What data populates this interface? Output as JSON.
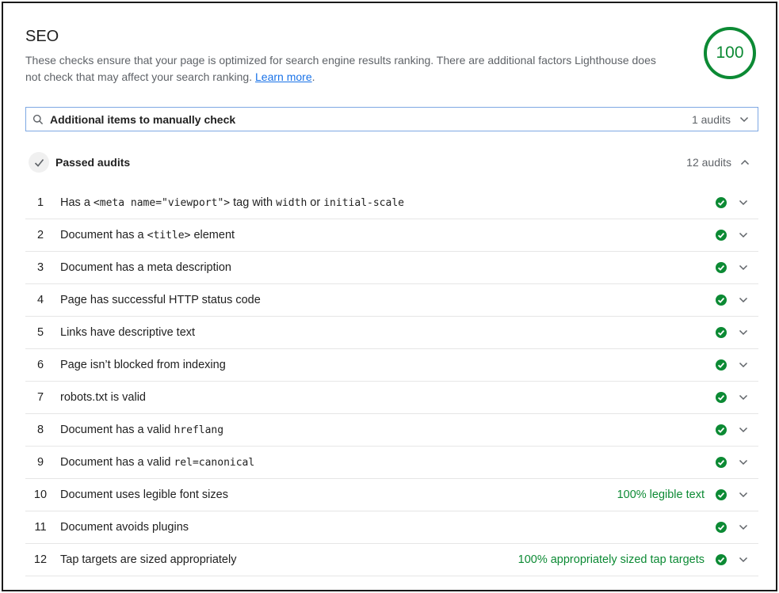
{
  "section": {
    "title": "SEO",
    "description": "These checks ensure that your page is optimized for search engine results ranking. There are additional factors Lighthouse does not check that may affect your search ranking.",
    "learn_more": "Learn more",
    "score": "100"
  },
  "manual": {
    "title": "Additional items to manually check",
    "count": "1 audits"
  },
  "passed": {
    "title": "Passed audits",
    "count": "12 audits"
  },
  "audits": [
    {
      "num": "1",
      "parts": [
        "Has a ",
        "<meta name=\"viewport\">",
        " tag with ",
        "width",
        " or ",
        "initial-scale"
      ],
      "extra": ""
    },
    {
      "num": "2",
      "parts": [
        "Document has a ",
        "<title>",
        " element"
      ],
      "extra": ""
    },
    {
      "num": "3",
      "parts": [
        "Document has a meta description"
      ],
      "extra": ""
    },
    {
      "num": "4",
      "parts": [
        "Page has successful HTTP status code"
      ],
      "extra": ""
    },
    {
      "num": "5",
      "parts": [
        "Links have descriptive text"
      ],
      "extra": ""
    },
    {
      "num": "6",
      "parts": [
        "Page isn’t blocked from indexing"
      ],
      "extra": ""
    },
    {
      "num": "7",
      "parts": [
        "robots.txt is valid"
      ],
      "extra": ""
    },
    {
      "num": "8",
      "parts": [
        "Document has a valid ",
        "hreflang"
      ],
      "extra": ""
    },
    {
      "num": "9",
      "parts": [
        "Document has a valid ",
        "rel=canonical"
      ],
      "extra": ""
    },
    {
      "num": "10",
      "parts": [
        "Document uses legible font sizes"
      ],
      "extra": "100% legible text"
    },
    {
      "num": "11",
      "parts": [
        "Document avoids plugins"
      ],
      "extra": ""
    },
    {
      "num": "12",
      "parts": [
        "Tap targets are sized appropriately"
      ],
      "extra": "100% appropriately sized tap targets"
    }
  ],
  "colors": {
    "pass": "#0c8a34",
    "link": "#1a73e8",
    "focus_border": "#7ea8e3"
  },
  "icons": {
    "manual": "search-icon",
    "passed": "checkmark-icon",
    "audit_status": "pass-check-icon",
    "expand": "chevron-down-icon",
    "collapse": "chevron-up-icon"
  }
}
